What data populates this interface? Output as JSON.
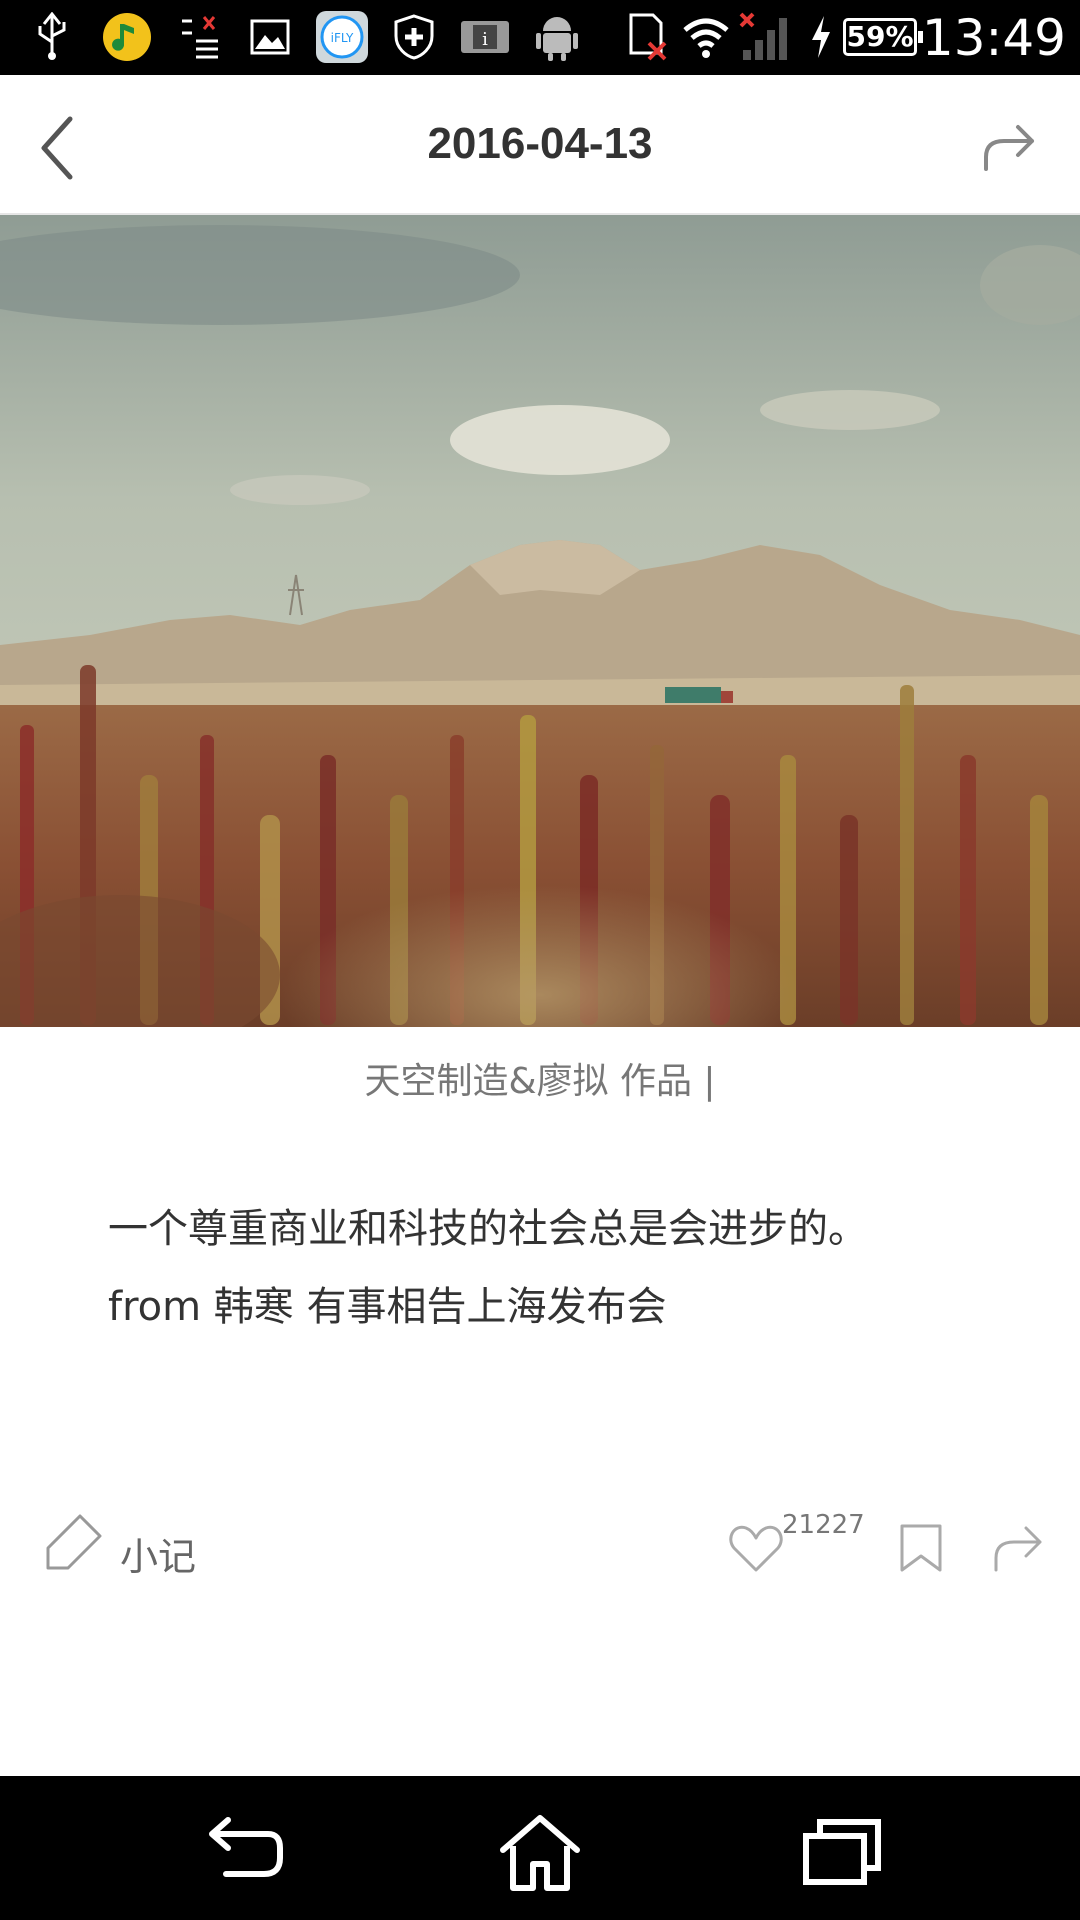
{
  "status_bar": {
    "battery": "59%",
    "time": "13:49",
    "icons": [
      "usb-icon",
      "music-app-icon",
      "tasks-icon",
      "gallery-icon",
      "ifly-icon",
      "shield-icon",
      "info-icon",
      "android-icon",
      "sd-card-icon",
      "wifi-icon",
      "signal-icon",
      "charging-icon"
    ]
  },
  "header": {
    "title": "2016-04-13",
    "back_icon": "chevron-left-icon",
    "share_icon": "share-arrow-icon"
  },
  "photo": {
    "description_icon": "landscape-photo",
    "colors": {
      "sky": "#b8c0b2",
      "mountain": "#b9a890",
      "field": "#8a5a3a"
    }
  },
  "caption": "天空制造&廖拟 作品 |",
  "quote": {
    "line1": "一个尊重商业和科技的社会总是会进步的。",
    "line2": "from  韩寒 有事相告上海发布会"
  },
  "actions": {
    "note_label": "小记",
    "like_count": "21227"
  },
  "nav_bar": {
    "icons": [
      "back-icon",
      "home-icon",
      "recent-apps-icon"
    ]
  }
}
